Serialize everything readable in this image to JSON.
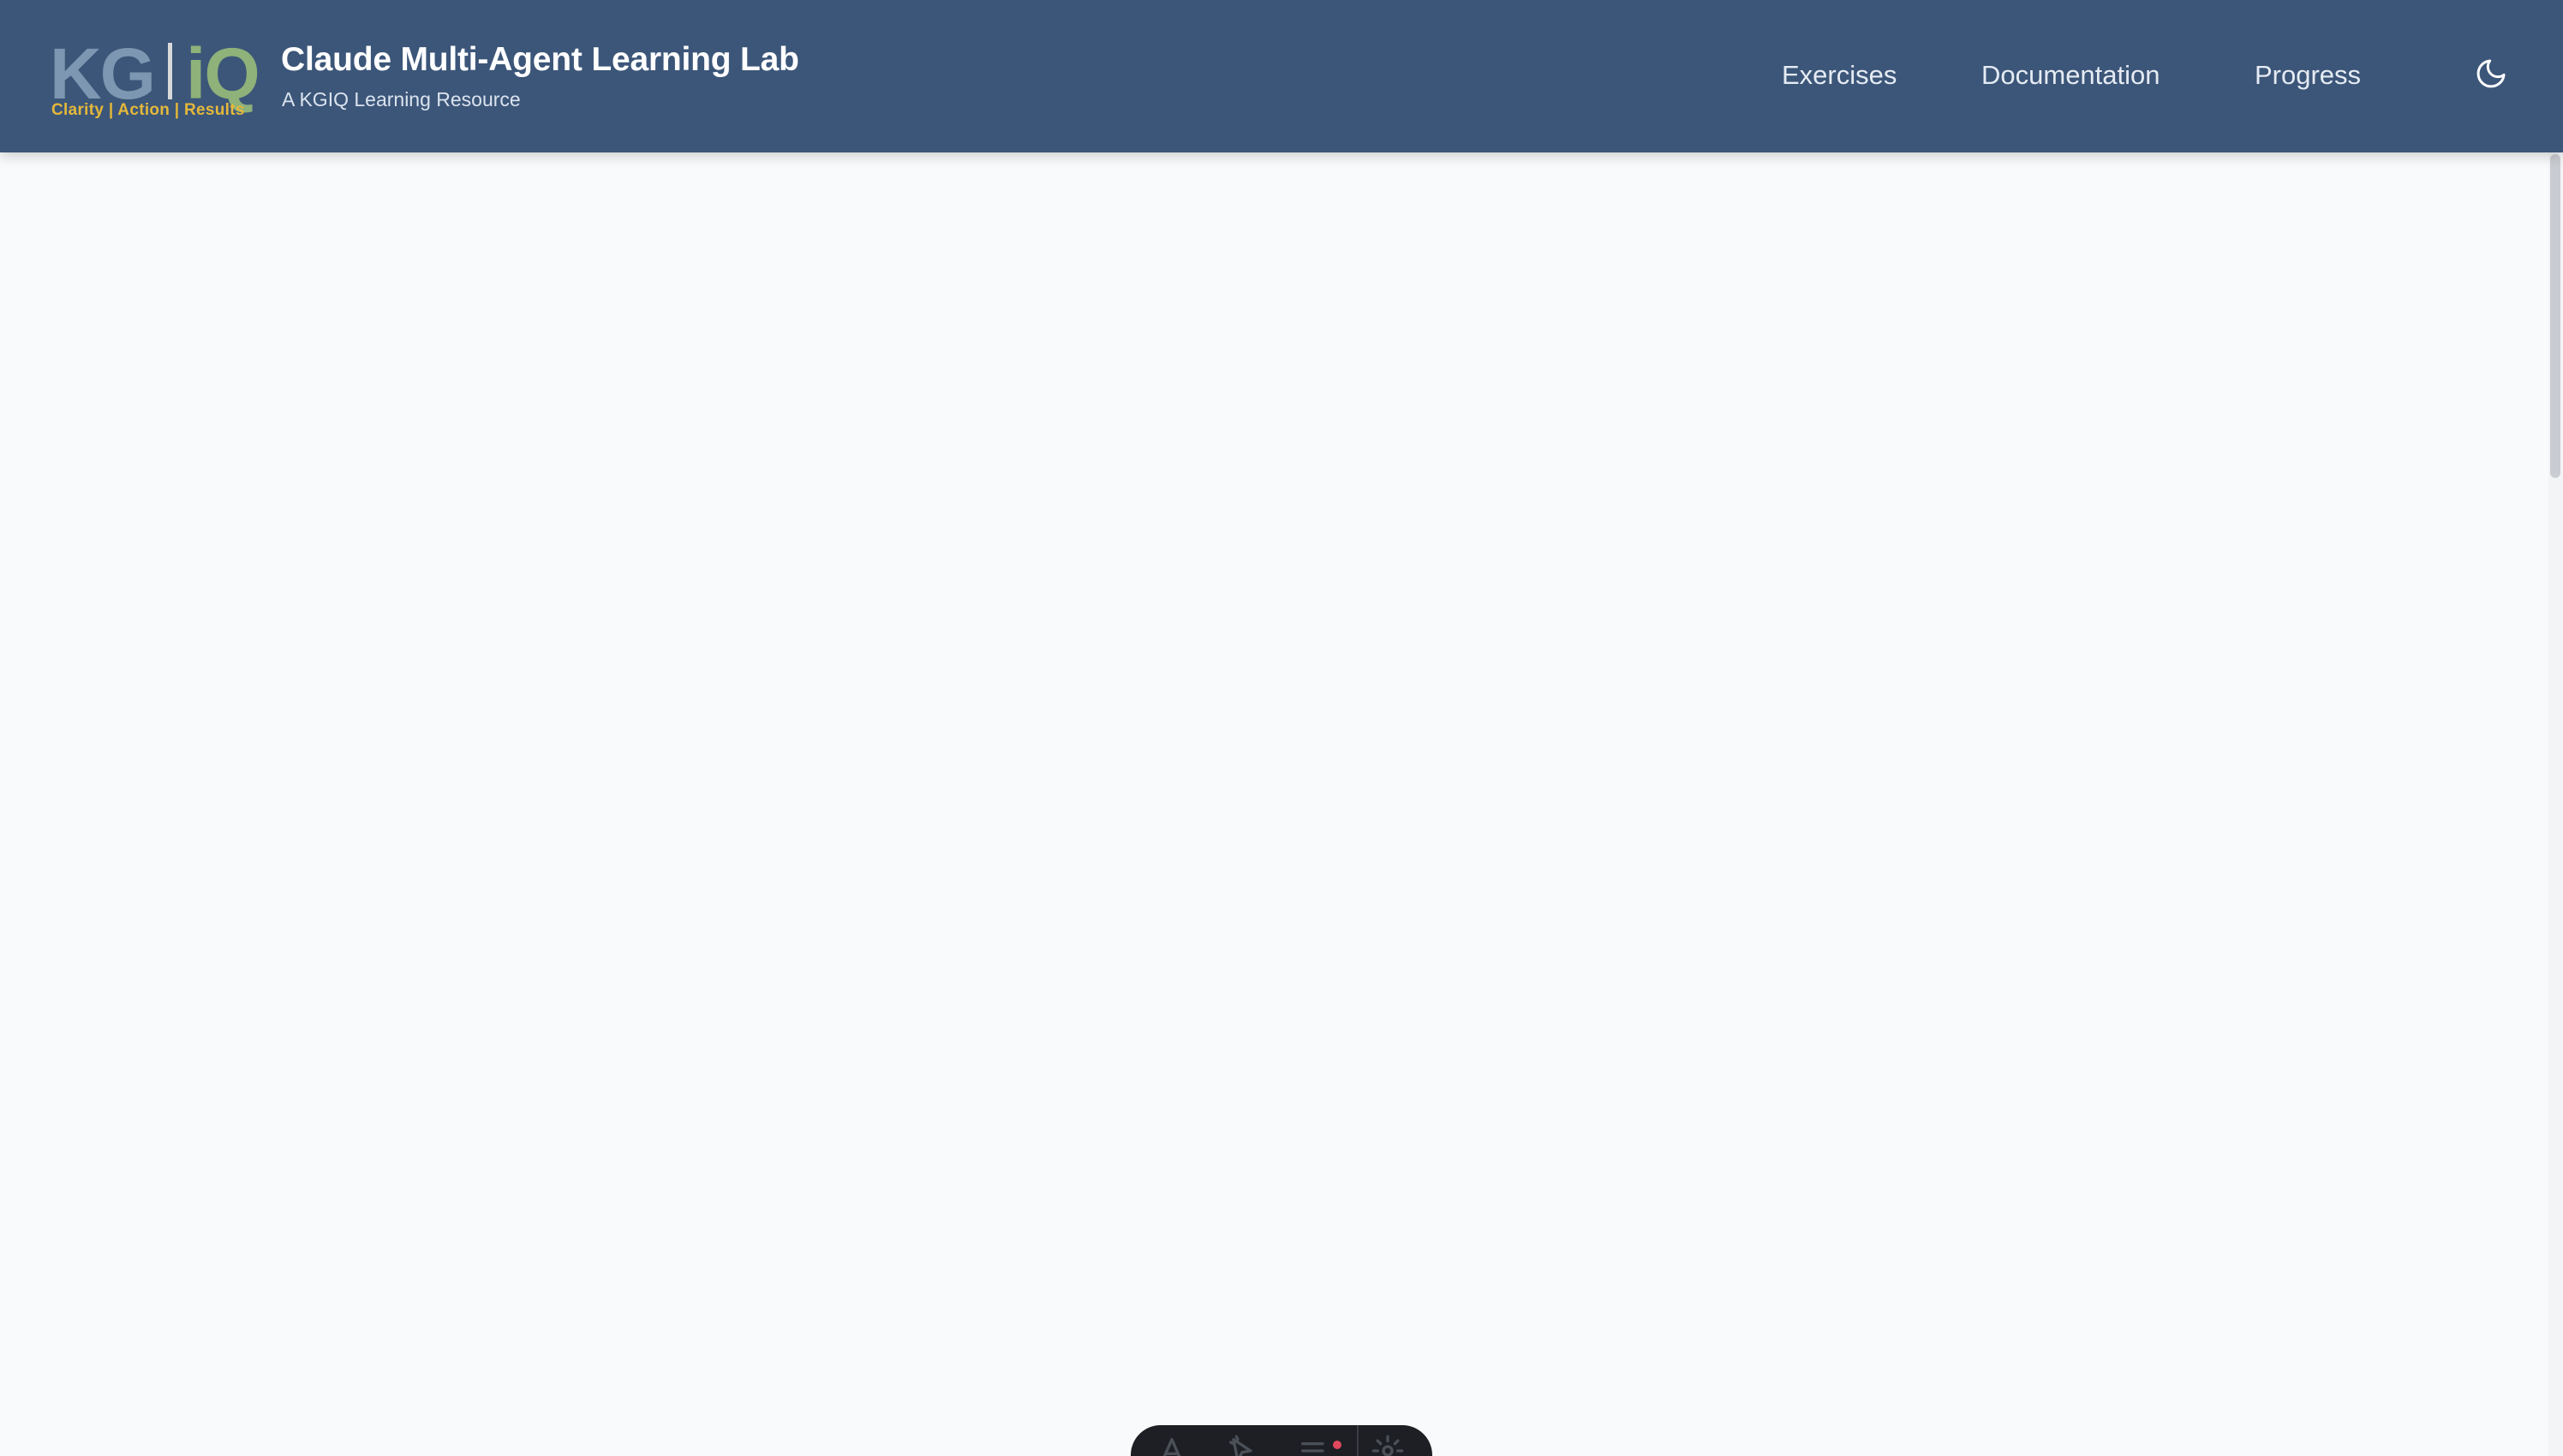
{
  "header": {
    "logo": {
      "kg": "KG",
      "iq": "iQ",
      "tagline": "Clarity | Action | Results"
    },
    "title": "Claude Multi-Agent Learning Lab",
    "subtitle": "A KGIQ Learning Resource",
    "nav": [
      {
        "label": "Exercises"
      },
      {
        "label": "Documentation"
      },
      {
        "label": "Progress"
      }
    ],
    "theme_toggle_icon": "moon-icon"
  },
  "toolbar": {
    "icons": [
      "a-text-icon",
      "cursor-icon",
      "menu-notification-icon",
      "gear-icon"
    ]
  },
  "colors": {
    "header_bg": "#3c5679",
    "page_bg": "#f9fafb",
    "logo_kg": "#7d97b2",
    "logo_iq": "#8fb17a",
    "logo_tagline": "#e4b83a",
    "toolbar_bg": "#1d1f24",
    "badge": "#e0485e"
  }
}
